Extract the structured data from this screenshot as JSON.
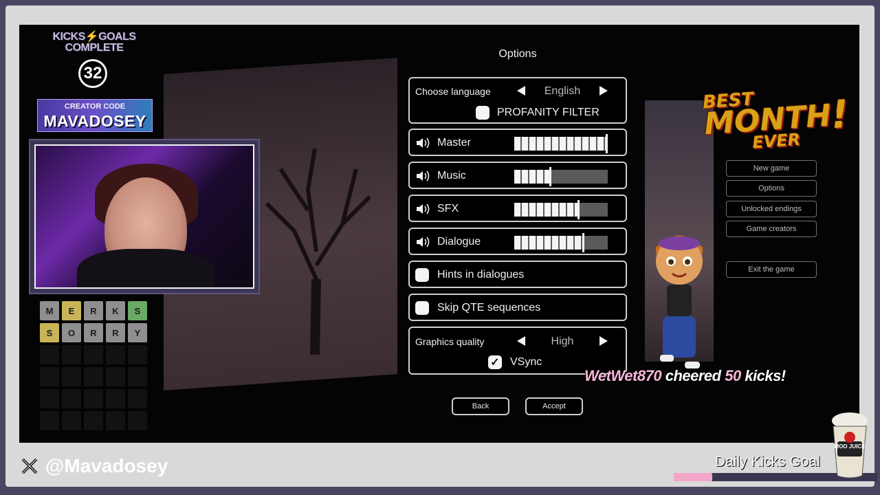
{
  "stream": {
    "kicks_goals_title": [
      "KICKS⚡GOALS",
      "COMPLETE"
    ],
    "kicks_goals_count": "32",
    "creator_code_label": "CREATOR CODE",
    "creator_code_value": "MAVADOSEY",
    "social_handle": "@Mavadosey",
    "goal_label": "Daily Kicks Goal",
    "goal_progress": 0.19,
    "cheer": {
      "user": "WetWet870",
      "middle": "cheered",
      "amount": "50",
      "unit": "kicks!"
    },
    "best_month": {
      "line1": "BEST",
      "line2": "MONTH",
      "line3": "EVER",
      "exclaim": "!"
    },
    "moo_juice": "MOO JUICE",
    "word_grid": {
      "rows": [
        [
          {
            "l": "M",
            "c": "#8f8f8f"
          },
          {
            "l": "E",
            "c": "#c9b458"
          },
          {
            "l": "R",
            "c": "#8f8f8f"
          },
          {
            "l": "K",
            "c": "#8f8f8f"
          },
          {
            "l": "S",
            "c": "#6aaa64"
          }
        ],
        [
          {
            "l": "S",
            "c": "#c9b458"
          },
          {
            "l": "O",
            "c": "#8f8f8f"
          },
          {
            "l": "R",
            "c": "#8f8f8f"
          },
          {
            "l": "R",
            "c": "#8f8f8f"
          },
          {
            "l": "Y",
            "c": "#8f8f8f"
          }
        ],
        [
          {
            "l": "",
            "c": "#121212"
          },
          {
            "l": "",
            "c": "#121212"
          },
          {
            "l": "",
            "c": "#121212"
          },
          {
            "l": "",
            "c": "#121212"
          },
          {
            "l": "",
            "c": "#121212"
          }
        ],
        [
          {
            "l": "",
            "c": "#121212"
          },
          {
            "l": "",
            "c": "#121212"
          },
          {
            "l": "",
            "c": "#121212"
          },
          {
            "l": "",
            "c": "#121212"
          },
          {
            "l": "",
            "c": "#121212"
          }
        ],
        [
          {
            "l": "",
            "c": "#121212"
          },
          {
            "l": "",
            "c": "#121212"
          },
          {
            "l": "",
            "c": "#121212"
          },
          {
            "l": "",
            "c": "#121212"
          },
          {
            "l": "",
            "c": "#121212"
          }
        ],
        [
          {
            "l": "",
            "c": "#121212"
          },
          {
            "l": "",
            "c": "#121212"
          },
          {
            "l": "",
            "c": "#121212"
          },
          {
            "l": "",
            "c": "#121212"
          },
          {
            "l": "",
            "c": "#121212"
          }
        ]
      ]
    }
  },
  "options": {
    "title": "Options",
    "language_label": "Choose language",
    "language_value": "English",
    "profanity_filter_label": "PROFANITY FILTER",
    "profanity_filter_checked": false,
    "volumes": [
      {
        "label": "Master",
        "level": 1.0
      },
      {
        "label": "Music",
        "level": 0.4
      },
      {
        "label": "SFX",
        "level": 0.7
      },
      {
        "label": "Dialogue",
        "level": 0.75
      }
    ],
    "hints_label": "Hints in dialogues",
    "hints_checked": false,
    "skip_qte_label": "Skip QTE sequences",
    "skip_qte_checked": false,
    "graphics_label": "Graphics quality",
    "graphics_value": "High",
    "vsync_label": "VSync",
    "vsync_checked": true,
    "back_label": "Back",
    "accept_label": "Accept"
  },
  "main_menu": {
    "items": [
      "New game",
      "Options",
      "Unlocked endings",
      "Game creators"
    ],
    "exit_label": "Exit the game"
  },
  "icons": {
    "speaker": "speaker-icon",
    "arrow_left": "triangle-left-icon",
    "arrow_right": "triangle-right-icon",
    "check": "checkmark-icon",
    "x_logo": "x-logo-icon"
  },
  "colors": {
    "accent_pink": "#f2a6c8",
    "best_gold": "#d8a216",
    "panel_border": "#cfcfcf"
  }
}
